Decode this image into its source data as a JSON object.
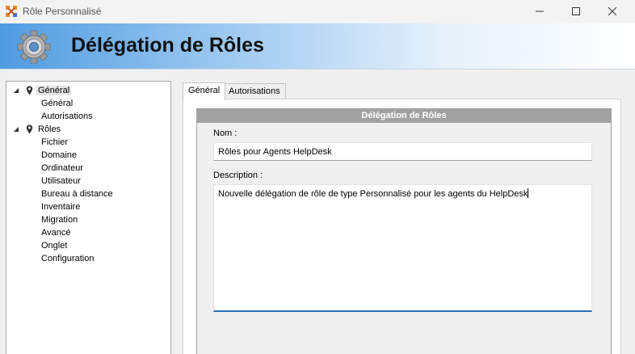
{
  "window": {
    "title": "Rôle Personnalisé",
    "minimize_icon": "minimize-icon",
    "maximize_icon": "maximize-icon",
    "close_icon": "close-icon"
  },
  "banner": {
    "title": "Délégation de Rôles",
    "icon": "gear-icon",
    "colors": {
      "gradient_start": "#4f9be0",
      "gradient_end": "#ffffff"
    }
  },
  "tree": [
    {
      "label": "Général",
      "level": 0,
      "expanded": true,
      "icon": "pin-icon",
      "selected": true
    },
    {
      "label": "Général",
      "level": 1
    },
    {
      "label": "Autorisations",
      "level": 1
    },
    {
      "label": "Rôles",
      "level": 0,
      "expanded": true,
      "icon": "pin-icon"
    },
    {
      "label": "Fichier",
      "level": 1
    },
    {
      "label": "Domaine",
      "level": 1
    },
    {
      "label": "Ordinateur",
      "level": 1
    },
    {
      "label": "Utilisateur",
      "level": 1
    },
    {
      "label": "Bureau à distance",
      "level": 1
    },
    {
      "label": "Inventaire",
      "level": 1
    },
    {
      "label": "Migration",
      "level": 1
    },
    {
      "label": "Avancé",
      "level": 1
    },
    {
      "label": "Onglet",
      "level": 1
    },
    {
      "label": "Configuration",
      "level": 1
    }
  ],
  "tabs": [
    {
      "label": "Général",
      "active": true
    },
    {
      "label": "Autorisations",
      "active": false
    }
  ],
  "form": {
    "header": "Délégation de Rôles",
    "name_label": "Nom :",
    "name_value": "Rôles pour Agents HelpDesk",
    "description_label": "Description :",
    "description_value": "Nouvelle délégation de rôle de type Personnalisé pour les agents du HelpDesk"
  }
}
